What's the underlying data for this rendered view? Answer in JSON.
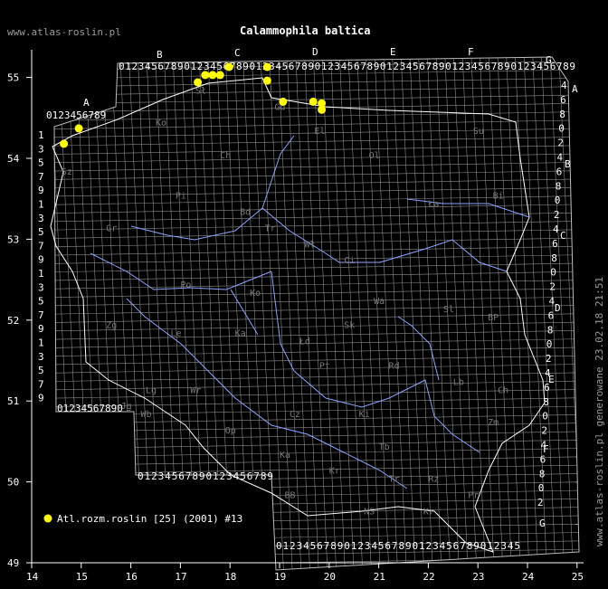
{
  "header": {
    "site": "www.atlas-roslin.pl",
    "title": "Calammophila baltica"
  },
  "side_note": "www.atlas-roslin.pl generowane 23.02.18 21:51",
  "axes": {
    "x_ticks": [
      "14",
      "15",
      "16",
      "17",
      "18",
      "19",
      "20",
      "21",
      "22",
      "23",
      "24",
      "25"
    ],
    "y_ticks": [
      "49",
      "50",
      "51",
      "52",
      "53",
      "54",
      "55"
    ]
  },
  "grid_letters": {
    "top": [
      "A",
      "B",
      "C",
      "D",
      "E",
      "F",
      "G"
    ],
    "right": [
      "A",
      "B",
      "C",
      "D",
      "E",
      "F",
      "G"
    ]
  },
  "grid_digits": {
    "top_a": "0123456789",
    "top_main": "0123456789012345678901234567890123456789012345678901234567890123456789",
    "left": [
      "1",
      "3",
      "5",
      "7",
      "9",
      "1",
      "3",
      "5",
      "7",
      "9",
      "1",
      "3",
      "5",
      "7",
      "9",
      "1",
      "3",
      "5",
      "7",
      "9"
    ],
    "bottom_left": "01234567890",
    "bottom_mid": "01234567890123456789",
    "bottom_right": "012345678901234567890123456789012345",
    "right": [
      "4",
      "6",
      "8",
      "0",
      "2",
      "4",
      "6",
      "8",
      "0",
      "2",
      "4",
      "6",
      "8",
      "0",
      "2",
      "4",
      "6",
      "8",
      "0",
      "2",
      "4",
      "6",
      "8",
      "0",
      "2",
      "4",
      "6",
      "8",
      "0",
      "2"
    ]
  },
  "regions": [
    {
      "code": "Ko",
      "lon": 16.5,
      "lat": 54.4
    },
    {
      "code": "Ch",
      "lon": 17.8,
      "lat": 54.0
    },
    {
      "code": "Sł",
      "lon": 17.3,
      "lat": 54.8
    },
    {
      "code": "Gd",
      "lon": 18.9,
      "lat": 54.6
    },
    {
      "code": "El",
      "lon": 19.7,
      "lat": 54.3
    },
    {
      "code": "Ol",
      "lon": 20.8,
      "lat": 54.0
    },
    {
      "code": "Su",
      "lon": 22.9,
      "lat": 54.3
    },
    {
      "code": "Pi",
      "lon": 16.9,
      "lat": 53.5
    },
    {
      "code": "Sz",
      "lon": 14.6,
      "lat": 53.8
    },
    {
      "code": "Gr",
      "lon": 15.5,
      "lat": 53.1
    },
    {
      "code": "Bd",
      "lon": 18.2,
      "lat": 53.3
    },
    {
      "code": "Tr",
      "lon": 18.7,
      "lat": 53.1
    },
    {
      "code": "Wł",
      "lon": 19.5,
      "lat": 52.9
    },
    {
      "code": "Ci",
      "lon": 20.3,
      "lat": 52.7
    },
    {
      "code": "Ła",
      "lon": 22.0,
      "lat": 53.4
    },
    {
      "code": "Bi",
      "lon": 23.3,
      "lat": 53.5
    },
    {
      "code": "Po",
      "lon": 17.0,
      "lat": 52.4
    },
    {
      "code": "Ko",
      "lon": 18.4,
      "lat": 52.3
    },
    {
      "code": "Wa",
      "lon": 20.9,
      "lat": 52.2
    },
    {
      "code": "Sl",
      "lon": 22.3,
      "lat": 52.1
    },
    {
      "code": "BP",
      "lon": 23.2,
      "lat": 52.0
    },
    {
      "code": "Zg",
      "lon": 15.5,
      "lat": 51.9
    },
    {
      "code": "Le",
      "lon": 16.8,
      "lat": 51.8
    },
    {
      "code": "Ka",
      "lon": 18.1,
      "lat": 51.8
    },
    {
      "code": "Łd",
      "lon": 19.4,
      "lat": 51.7
    },
    {
      "code": "Sk",
      "lon": 20.3,
      "lat": 51.9
    },
    {
      "code": "Pt",
      "lon": 19.8,
      "lat": 51.4
    },
    {
      "code": "Rd",
      "lon": 21.2,
      "lat": 51.4
    },
    {
      "code": "Lb",
      "lon": 22.5,
      "lat": 51.2
    },
    {
      "code": "Ch",
      "lon": 23.4,
      "lat": 51.1
    },
    {
      "code": "Lg",
      "lon": 16.3,
      "lat": 51.1
    },
    {
      "code": "Wr",
      "lon": 17.2,
      "lat": 51.1
    },
    {
      "code": "Jg",
      "lon": 15.8,
      "lat": 50.9
    },
    {
      "code": "Wb",
      "lon": 16.2,
      "lat": 50.8
    },
    {
      "code": "Cz",
      "lon": 19.2,
      "lat": 50.8
    },
    {
      "code": "Ki",
      "lon": 20.6,
      "lat": 50.8
    },
    {
      "code": "Zm",
      "lon": 23.2,
      "lat": 50.7
    },
    {
      "code": "Op",
      "lon": 17.9,
      "lat": 50.6
    },
    {
      "code": "Ka",
      "lon": 19.0,
      "lat": 50.3
    },
    {
      "code": "Tb",
      "lon": 21.0,
      "lat": 50.4
    },
    {
      "code": "Tr",
      "lon": 21.2,
      "lat": 50.0
    },
    {
      "code": "Rz",
      "lon": 22.0,
      "lat": 50.0
    },
    {
      "code": "Kr",
      "lon": 20.0,
      "lat": 50.1
    },
    {
      "code": "Pr",
      "lon": 22.8,
      "lat": 49.8
    },
    {
      "code": "BB",
      "lon": 19.1,
      "lat": 49.8
    },
    {
      "code": "NS",
      "lon": 20.7,
      "lat": 49.6
    },
    {
      "code": "Kr",
      "lon": 21.9,
      "lat": 49.6
    }
  ],
  "chart_data": {
    "type": "scatter",
    "title": "Calammophila baltica",
    "xlim": [
      14,
      25
    ],
    "ylim": [
      49,
      55.6
    ],
    "series": [
      {
        "name": "Atl.rozm.roslin [25] (2001) #13",
        "color": "#ffff00",
        "points": [
          {
            "lon": 14.65,
            "lat": 54.18
          },
          {
            "lon": 14.95,
            "lat": 54.37
          },
          {
            "lon": 17.35,
            "lat": 54.94
          },
          {
            "lon": 17.5,
            "lat": 55.03
          },
          {
            "lon": 17.65,
            "lat": 55.03
          },
          {
            "lon": 17.8,
            "lat": 55.03
          },
          {
            "lon": 17.98,
            "lat": 55.13
          },
          {
            "lon": 18.75,
            "lat": 55.13
          },
          {
            "lon": 18.75,
            "lat": 54.96
          },
          {
            "lon": 19.07,
            "lat": 54.7
          },
          {
            "lon": 19.68,
            "lat": 54.7
          },
          {
            "lon": 19.85,
            "lat": 54.68
          },
          {
            "lon": 19.85,
            "lat": 54.6
          }
        ]
      }
    ]
  }
}
